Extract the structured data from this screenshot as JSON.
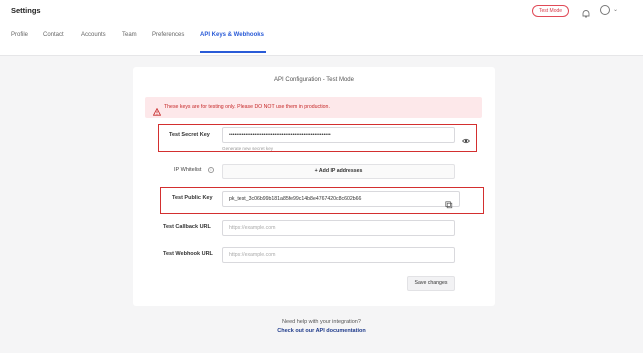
{
  "header": {
    "title": "Settings",
    "test_mode_badge": "Test Mode",
    "icons": [
      "bell-icon",
      "user-avatar-icon",
      "chevron-down-icon"
    ]
  },
  "tabs": [
    "Profile",
    "Contact",
    "Accounts",
    "Team",
    "Preferences",
    "API Keys & Webhooks"
  ],
  "card": {
    "title": "API Configuration - Test Mode",
    "alert": "These keys are for testing only. Please DO NOT use them in production.",
    "secret_key": {
      "label": "Test Secret Key",
      "value": "••••••••••••••••••••••••••••••••••••••••••••••••••••••••",
      "helper": "Generate new secret key"
    },
    "ip_whitelist": {
      "label": "IP Whitelist",
      "button": "+ Add IP addresses"
    },
    "public_key": {
      "label": "Test Public Key",
      "value": "pk_test_3c06b99b181a85fe99c14b8e4767420c8c602b66"
    },
    "callback": {
      "label": "Test Callback URL",
      "placeholder": "https://example.com"
    },
    "webhook": {
      "label": "Test Webhook URL",
      "placeholder": "https://example.com"
    },
    "save_button": "Save changes"
  },
  "footer": {
    "help_text": "Need help with your integration?",
    "doc_link": "Check out our API documentation"
  },
  "colors": {
    "accent": "#2a5bd7",
    "alert_bg": "#fde8ea",
    "alert_text": "#c62828",
    "highlight": "#d32f2f"
  }
}
